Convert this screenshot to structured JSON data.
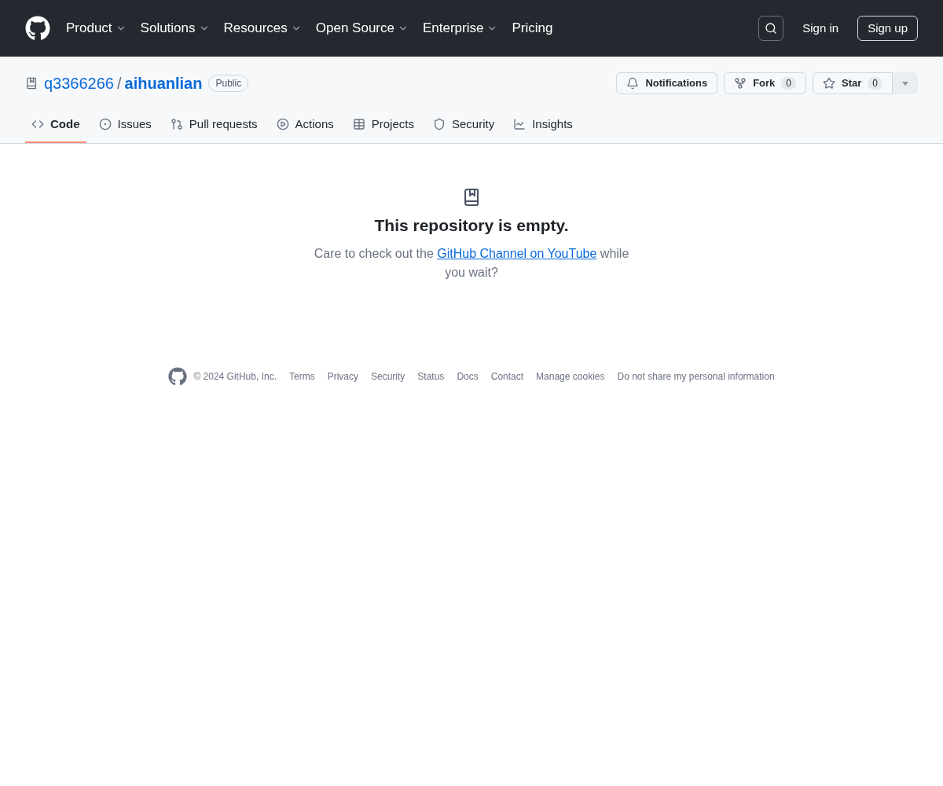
{
  "header": {
    "menu": [
      {
        "label": "Product",
        "dropdown": true
      },
      {
        "label": "Solutions",
        "dropdown": true
      },
      {
        "label": "Resources",
        "dropdown": true
      },
      {
        "label": "Open Source",
        "dropdown": true
      },
      {
        "label": "Enterprise",
        "dropdown": true
      },
      {
        "label": "Pricing",
        "dropdown": false
      }
    ],
    "sign_in": "Sign in",
    "sign_up": "Sign up"
  },
  "repo": {
    "owner": "q3366266",
    "separator": "/",
    "name": "aihuanlian",
    "visibility": "Public",
    "actions": [
      {
        "kind": "notifications",
        "label": "Notifications"
      },
      {
        "kind": "fork",
        "label": "Fork",
        "count": "0"
      },
      {
        "kind": "star",
        "label": "Star",
        "count": "0"
      }
    ],
    "tabs": [
      {
        "kind": "code",
        "label": "Code",
        "selected": true
      },
      {
        "kind": "issues",
        "label": "Issues",
        "selected": false
      },
      {
        "kind": "pulls",
        "label": "Pull requests",
        "selected": false
      },
      {
        "kind": "actions",
        "label": "Actions",
        "selected": false
      },
      {
        "kind": "projects",
        "label": "Projects",
        "selected": false
      },
      {
        "kind": "security",
        "label": "Security",
        "selected": false
      },
      {
        "kind": "insights",
        "label": "Insights",
        "selected": false
      }
    ]
  },
  "empty": {
    "title": "This repository is empty.",
    "before": "Care to check out the",
    "link": "GitHub Channel on YouTube",
    "after": "while you wait?"
  },
  "footer": {
    "copyright": "© 2024 GitHub, Inc.",
    "links": [
      "Terms",
      "Privacy",
      "Security",
      "Status",
      "Docs",
      "Contact",
      "Manage cookies",
      "Do not share my personal information"
    ]
  }
}
